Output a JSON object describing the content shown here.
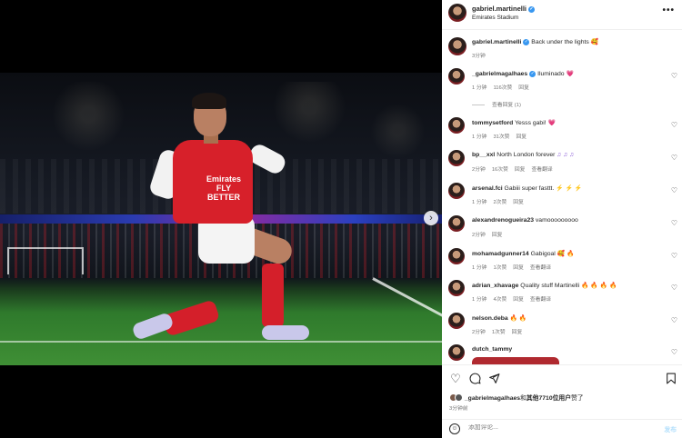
{
  "post": {
    "username": "gabriel.martinelli",
    "location": "Emirates Stadium",
    "sponsor_text": "Emirates\nFLY BETTER",
    "caption_user": "gabriel.martinelli",
    "caption_text": "Back under the lights",
    "caption_emoji": "🥰",
    "caption_time": "3分钟"
  },
  "comments": [
    {
      "user": "_gabrielmagalhaes",
      "verified": true,
      "text": "Iluminado",
      "emoji": "💗",
      "emoji_color": "pink",
      "time": "1 分钟",
      "likes": "116次赞",
      "reply": "回复",
      "view_replies": "查看回复 (1)"
    },
    {
      "user": "tommysetford",
      "verified": false,
      "text": "Yesss gabi!",
      "emoji": "💗",
      "emoji_color": "pink",
      "time": "1 分钟",
      "likes": "31次赞",
      "reply": "回复"
    },
    {
      "user": "bp__xxl",
      "verified": false,
      "text": "North London forever",
      "emoji": "♫ ♫ ♫",
      "emoji_color": "purple",
      "time": "2分钟",
      "likes": "16次赞",
      "reply": "回复",
      "translate": "查看翻译"
    },
    {
      "user": "arsenal.fci",
      "verified": false,
      "text": "Gabiii super fasttt.",
      "emoji": "⚡ ⚡ ⚡",
      "emoji_color": "orange",
      "time": "1 分钟",
      "likes": "2次赞",
      "reply": "回复"
    },
    {
      "user": "alexandrenogueira23",
      "verified": false,
      "text": "vamooooooooo",
      "emoji": "",
      "emoji_color": "",
      "time": "2分钟",
      "likes": "",
      "reply": "回复"
    },
    {
      "user": "mohamadgunner14",
      "verified": false,
      "text": "Gabigoal",
      "emoji": "🥰 🔥",
      "emoji_color": "orange",
      "time": "1 分钟",
      "likes": "1次赞",
      "reply": "回复",
      "translate": "查看翻译"
    },
    {
      "user": "adrian_xhavage",
      "verified": false,
      "text": "Quality stuff Martinelli",
      "emoji": "🔥 🔥 🔥 🔥",
      "emoji_color": "orange",
      "time": "1 分钟",
      "likes": "4次赞",
      "reply": "回复",
      "translate": "查看翻译"
    },
    {
      "user": "nelson.deba",
      "verified": false,
      "text": "",
      "emoji": "🔥 🔥",
      "emoji_color": "orange",
      "time": "2分钟",
      "likes": "1次赞",
      "reply": "回复"
    },
    {
      "user": "dutch_tammy",
      "verified": false,
      "text": "",
      "emoji": "",
      "emoji_color": "",
      "time": "",
      "likes": "",
      "reply": ""
    }
  ],
  "actions": {
    "like_icon": "heart-icon",
    "comment_icon": "comment-icon",
    "share_icon": "share-icon",
    "save_icon": "bookmark-icon"
  },
  "likes_summary": {
    "user": "_gabrielmagalhaes",
    "middle": "和",
    "others": "其他7710位用户",
    "suffix": "赞了"
  },
  "post_time": "3分钟前",
  "composer": {
    "placeholder": "添加评论...",
    "post_label": "发布"
  },
  "colors": {
    "verified": "#3897f0",
    "link": "#b2dffc",
    "arsenal_red": "#d7202a"
  }
}
